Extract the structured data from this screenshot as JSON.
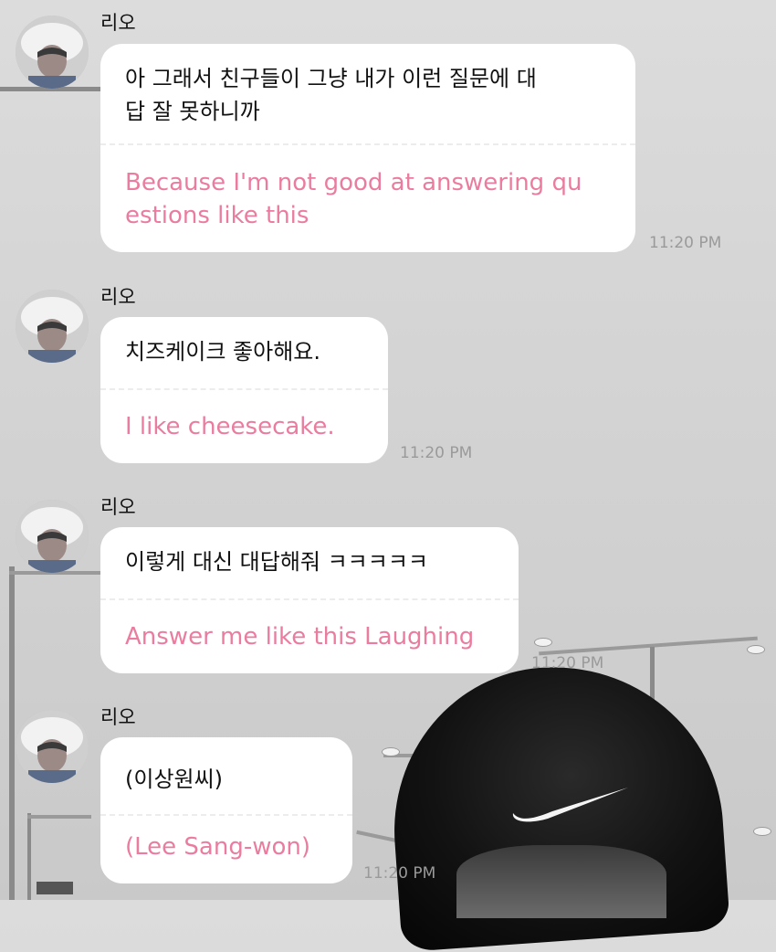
{
  "messages": [
    {
      "sender": "리오",
      "original": "아 그래서 친구들이 그냥 내가 이런 질문에 대\n답 잘 못하니까",
      "translation": "Because I'm not good at answering qu\nestions like this",
      "time": "11:20 PM"
    },
    {
      "sender": "리오",
      "original": "치즈케이크 좋아해요.",
      "translation": "I like cheesecake.",
      "time": "11:20 PM"
    },
    {
      "sender": "리오",
      "original": "이렇게 대신 대답해줘 ㅋㅋㅋㅋㅋ",
      "translation": "Answer me like this Laughing",
      "time": "11:20 PM"
    },
    {
      "sender": "리오",
      "original": "(이상원씨)",
      "translation": "(Lee Sang-won)",
      "time": "11:20 PM"
    }
  ],
  "colors": {
    "translation": "#ea7d9f",
    "bubble": "#ffffff",
    "timestamp": "#9a9a9a"
  },
  "icons": [
    "avatar-photo",
    "nike-swoosh"
  ]
}
